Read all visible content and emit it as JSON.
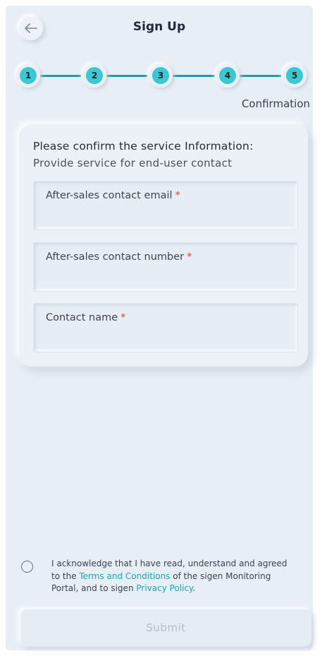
{
  "header": {
    "title": "Sign Up",
    "back_icon": "arrow-left-icon"
  },
  "stepper": {
    "steps": [
      "1",
      "2",
      "3",
      "4",
      "5"
    ],
    "current_step": 5,
    "current_caption": "Confirmation",
    "accent_color": "#3cc7d2",
    "line_color": "#1f9aa6"
  },
  "card": {
    "heading": "Please confirm the service Information:",
    "subheading": "Provide service for end-user contact",
    "fields": [
      {
        "label": "After-sales contact email",
        "required_mark": "*",
        "value": ""
      },
      {
        "label": "After-sales contact number",
        "required_mark": "*",
        "value": ""
      },
      {
        "label": "Contact name",
        "required_mark": "*",
        "value": ""
      }
    ]
  },
  "agreement": {
    "checked": false,
    "text_1": "I acknowledge that I have read, understand and agreed to the ",
    "terms_link": "Terms and Conditions",
    "text_2": " of the sigen Monitoring Portal, and to sigen ",
    "privacy_link": "Privacy Policy",
    "text_3": "."
  },
  "submit": {
    "label": "Submit",
    "disabled": true
  },
  "colors": {
    "background": "#e8eef6",
    "required": "#e0463f",
    "link": "#1fa6b3"
  }
}
